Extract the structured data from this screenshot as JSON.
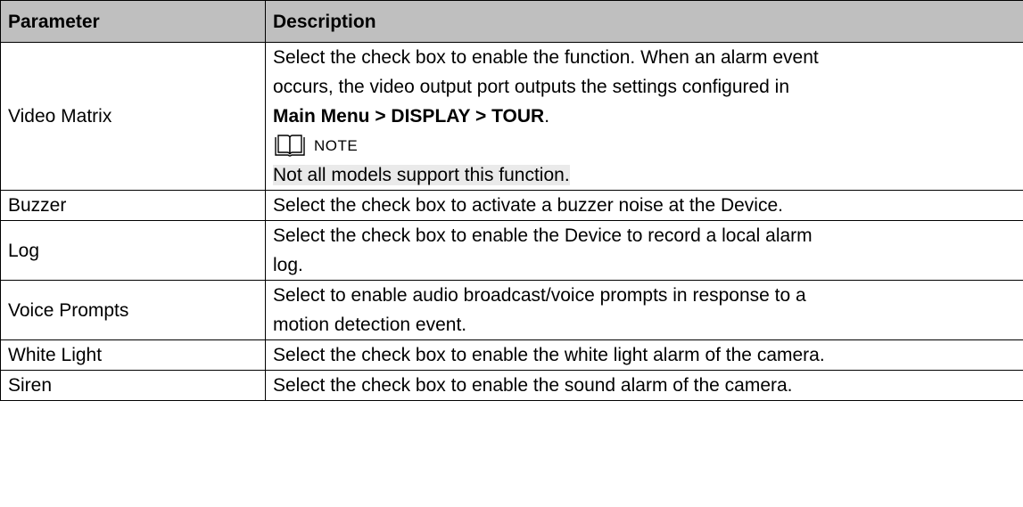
{
  "table": {
    "headers": {
      "parameter": "Parameter",
      "description": "Description"
    },
    "video_matrix": {
      "param": "Video Matrix",
      "desc_line1": "Select the check box to enable the function. When an alarm event",
      "desc_line2": "occurs, the video output port outputs the settings configured in",
      "menu_path": "Main Menu > DISPLAY > TOUR",
      "period": ".",
      "note_icon": "book-icon",
      "note_label": "NOTE",
      "note_text": "Not all models support this function."
    },
    "buzzer": {
      "param": "Buzzer",
      "desc": "Select the check box to activate a buzzer noise at the Device."
    },
    "log": {
      "param": "Log",
      "desc_line1": "Select the check box to enable the Device to record a local alarm",
      "desc_line2": "log."
    },
    "voice_prompts": {
      "param": "Voice Prompts",
      "desc_line1": "Select to enable audio broadcast/voice prompts in response to a",
      "desc_line2": "motion detection event."
    },
    "white_light": {
      "param": "White Light",
      "desc": "Select the check box to enable the white light alarm of the camera."
    },
    "siren": {
      "param": "Siren",
      "desc": "Select the check box to enable the sound alarm of the camera."
    }
  }
}
